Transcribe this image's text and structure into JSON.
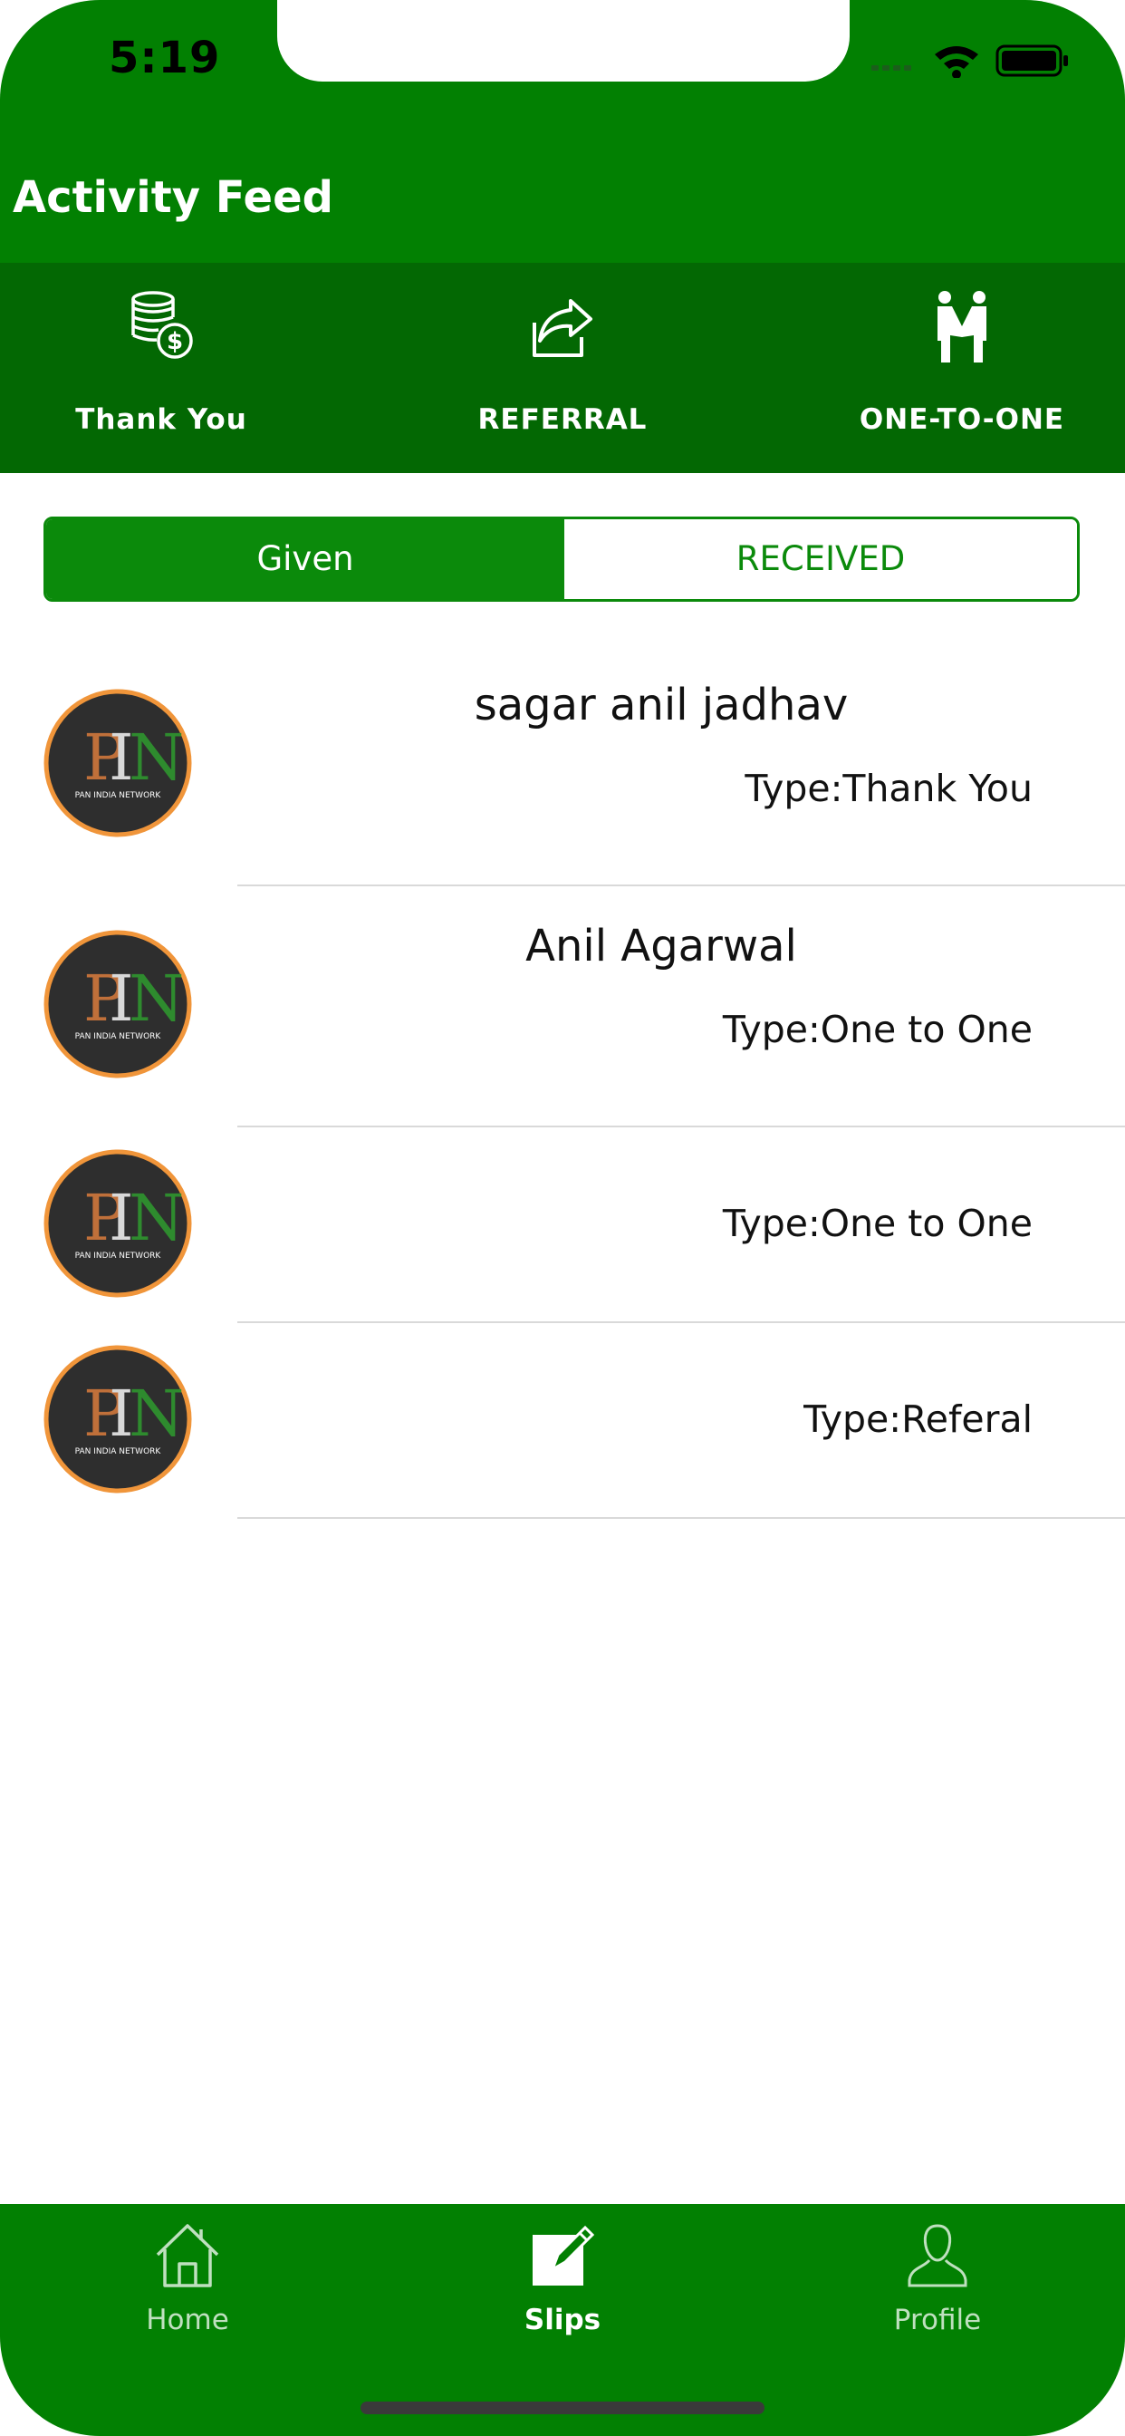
{
  "status_bar": {
    "time": "5:19"
  },
  "header": {
    "title": "Activity Feed"
  },
  "actions": [
    {
      "label": "Thank You",
      "icon": "coins-dollar-icon"
    },
    {
      "label": "REFERRAL",
      "icon": "share-arrow-icon"
    },
    {
      "label": "ONE-TO-ONE",
      "icon": "handshake-people-icon"
    }
  ],
  "segments": {
    "given": "Given",
    "received": "RECEIVED",
    "selected": "Given"
  },
  "feed": [
    {
      "name": "sagar anil jadhav",
      "type": "Type:Thank You"
    },
    {
      "name": "Anil Agarwal",
      "type": "Type:One to One"
    },
    {
      "name": "",
      "type": "Type:One to One"
    },
    {
      "name": "",
      "type": "Type:Referal"
    }
  ],
  "logo": {
    "letters": "PIN",
    "tagline": "PAN INDIA NETWORK"
  },
  "tabbar": [
    {
      "label": "Home",
      "icon": "home-icon"
    },
    {
      "label": "Slips",
      "icon": "edit-slip-icon"
    },
    {
      "label": "Profile",
      "icon": "profile-icon"
    }
  ],
  "colors": {
    "primary": "#028002",
    "actions_bg": "#036803",
    "accent": "#0b8a0b",
    "avatar_ring": "#f0953a"
  }
}
